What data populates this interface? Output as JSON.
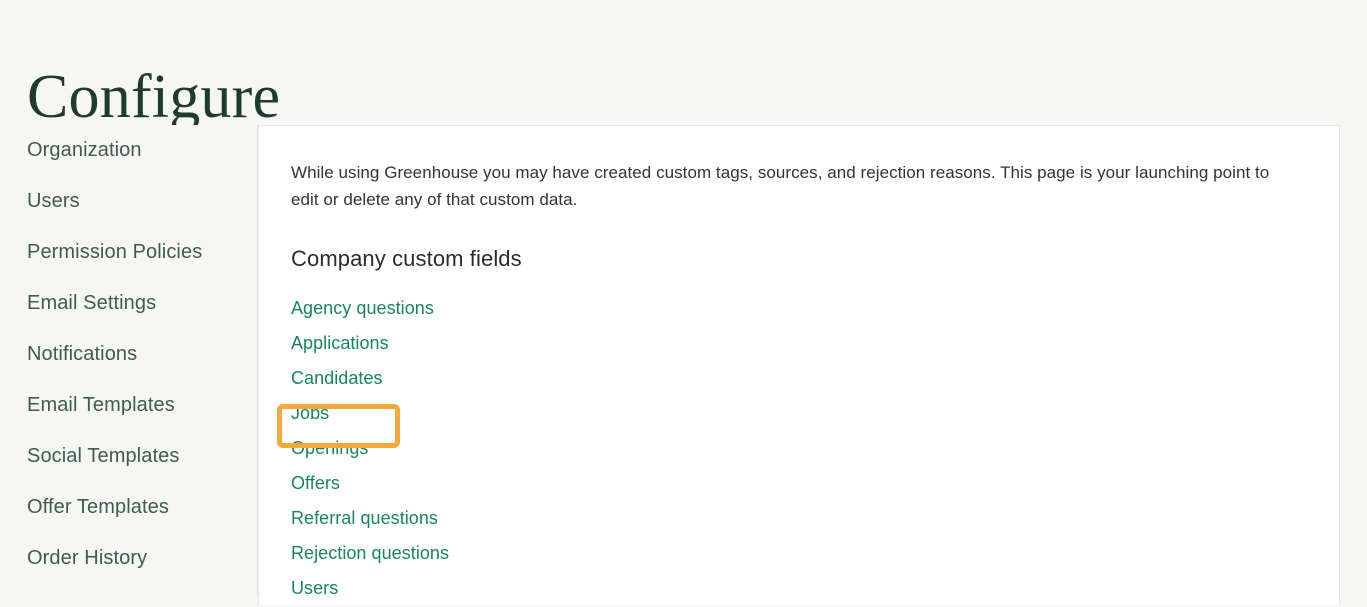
{
  "header": {
    "title": "Configure"
  },
  "sidebar": {
    "items": [
      {
        "label": "Organization"
      },
      {
        "label": "Users"
      },
      {
        "label": "Permission Policies"
      },
      {
        "label": "Email Settings"
      },
      {
        "label": "Notifications"
      },
      {
        "label": "Email Templates"
      },
      {
        "label": "Social Templates"
      },
      {
        "label": "Offer Templates"
      },
      {
        "label": "Order History"
      }
    ]
  },
  "main": {
    "intro": "While using Greenhouse you may have created custom tags, sources, and rejection reasons. This page is your launching point to edit or delete any of that custom data.",
    "section_heading": "Company custom fields",
    "custom_fields": [
      {
        "label": "Agency questions"
      },
      {
        "label": "Applications"
      },
      {
        "label": "Candidates"
      },
      {
        "label": "Jobs"
      },
      {
        "label": "Openings"
      },
      {
        "label": "Offers"
      },
      {
        "label": "Referral questions"
      },
      {
        "label": "Rejection questions"
      },
      {
        "label": "Users"
      }
    ]
  },
  "annotation": {
    "highlighted_item": "Openings",
    "highlight_color": "#f5a93b"
  },
  "colors": {
    "page_background": "#f6f6f5",
    "panel_background": "#ffffff",
    "title_text": "#1f3b2c",
    "sidebar_text": "#3e5c50",
    "link_green": "#17865a",
    "body_text": "#333333"
  }
}
